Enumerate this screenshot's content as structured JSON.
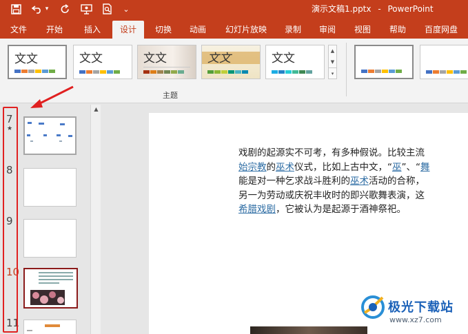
{
  "window": {
    "document_title": "演示文稿1.pptx",
    "separator": "-",
    "app_name": "PowerPoint"
  },
  "quick_access": [
    {
      "name": "save-icon",
      "glyph": "🖫"
    },
    {
      "name": "undo-icon",
      "glyph": "↶"
    },
    {
      "name": "undo-dropdown-icon",
      "glyph": "▾"
    },
    {
      "name": "redo-icon",
      "glyph": "↻"
    },
    {
      "name": "present-from-start-icon",
      "glyph": "⛉"
    },
    {
      "name": "print-preview-icon",
      "glyph": "⎙"
    },
    {
      "name": "customize-quick-access-icon",
      "glyph": "⌄"
    }
  ],
  "tabs": [
    {
      "label": "文件",
      "active": false
    },
    {
      "label": "开始",
      "active": false
    },
    {
      "label": "插入",
      "active": false
    },
    {
      "label": "设计",
      "active": true
    },
    {
      "label": "切换",
      "active": false
    },
    {
      "label": "动画",
      "active": false
    },
    {
      "label": "幻灯片放映",
      "active": false
    },
    {
      "label": "录制",
      "active": false
    },
    {
      "label": "审阅",
      "active": false
    },
    {
      "label": "视图",
      "active": false
    },
    {
      "label": "帮助",
      "active": false
    },
    {
      "label": "百度网盘",
      "active": false
    }
  ],
  "ribbon": {
    "themes": [
      {
        "sample_text": "文文",
        "selected": true
      },
      {
        "sample_text": "文文",
        "selected": false
      },
      {
        "sample_text": "文文",
        "selected": false
      },
      {
        "sample_text": "文文",
        "selected": false
      },
      {
        "sample_text": "文文",
        "selected": false
      }
    ],
    "theme_group_label": "主题",
    "gallery_scroll": {
      "up": "▲",
      "down": "▼",
      "more": "▾"
    }
  },
  "thumbnails": [
    {
      "number": "7",
      "has_animation": true,
      "star": "★",
      "selected": false
    },
    {
      "number": "8",
      "has_animation": false,
      "selected": false
    },
    {
      "number": "9",
      "has_animation": false,
      "selected": false
    },
    {
      "number": "10",
      "has_animation": false,
      "selected": true
    },
    {
      "number": "11",
      "has_animation": false,
      "selected": false
    }
  ],
  "thumbnail_scroll_up": "▲",
  "slide_text": {
    "lines": [
      [
        {
          "t": "戏剧的起源实不可考，有多种假说。比较主流"
        }
      ],
      [
        {
          "t": "始宗教",
          "link": true
        },
        {
          "t": "的"
        },
        {
          "t": "巫术",
          "link": true
        },
        {
          "t": "仪式，比如上古中文，“"
        },
        {
          "t": "巫",
          "link": true
        },
        {
          "t": "”、“"
        },
        {
          "t": "舞",
          "link": true
        }
      ],
      [
        {
          "t": "能是对一种乞求战斗胜利的"
        },
        {
          "t": "巫术",
          "link": true
        },
        {
          "t": "活动的合称，"
        }
      ],
      [
        {
          "t": "另一为劳动或庆祝丰收时的即兴歌舞表演，这"
        }
      ],
      [
        {
          "t": "希腊戏剧",
          "link": true
        },
        {
          "t": "，它被认为是起源于酒神祭祀。"
        }
      ]
    ]
  },
  "watermark": {
    "name": "极光下载站",
    "url": "www.xz7.com"
  },
  "colors": {
    "accent": "#c43e1c",
    "link": "#2e6da4",
    "annotation_red": "#e02020",
    "watermark_blue": "#1b61b8"
  }
}
